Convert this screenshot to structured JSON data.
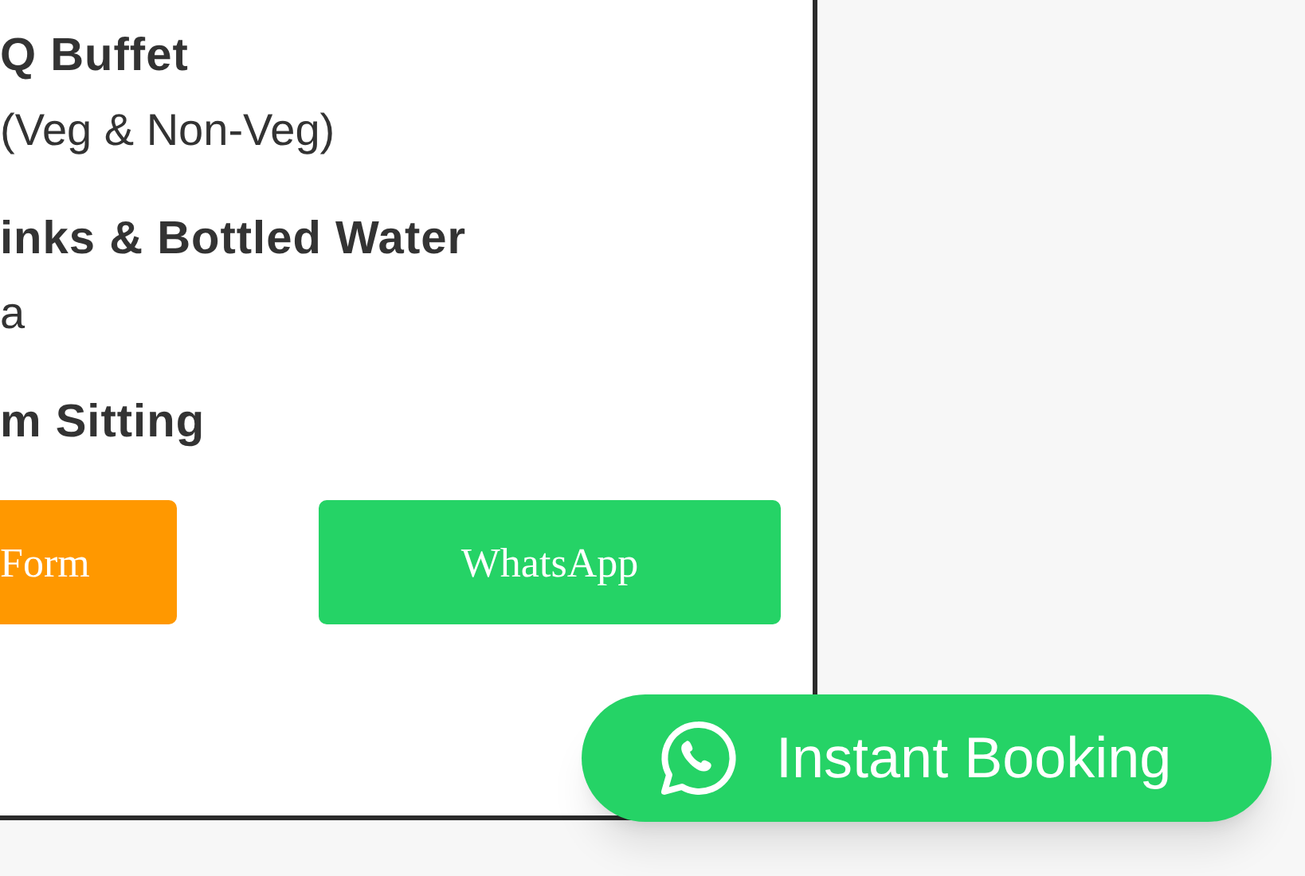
{
  "menu_items": [
    {
      "kind": "heading",
      "text": "Q Buffet"
    },
    {
      "kind": "detail",
      "text": "(Veg & Non-Veg)"
    },
    {
      "kind": "heading",
      "text": "inks & Bottled Water"
    },
    {
      "kind": "detail",
      "text": "a"
    },
    {
      "kind": "heading",
      "text": "m Sitting"
    }
  ],
  "buttons": [
    {
      "kind": "form",
      "label": "Form"
    },
    {
      "kind": "whatsapp",
      "label": "WhatsApp"
    }
  ],
  "floating_button": {
    "label": "Instant Booking"
  }
}
